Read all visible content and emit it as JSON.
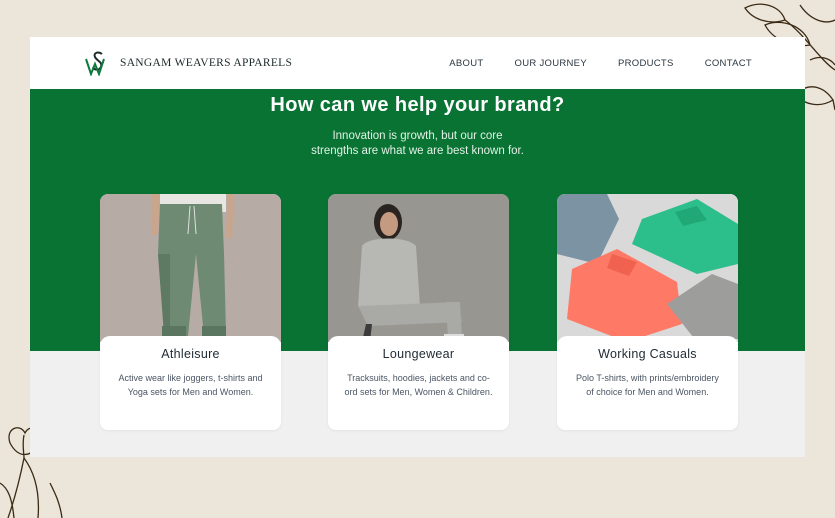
{
  "brand": {
    "name": "SANGAM WEAVERS APPARELS",
    "logo_icon": "sw-monogram-icon"
  },
  "nav": {
    "items": [
      {
        "label": "ABOUT"
      },
      {
        "label": "OUR JOURNEY"
      },
      {
        "label": "PRODUCTS"
      },
      {
        "label": "CONTACT"
      }
    ]
  },
  "hero": {
    "title": "How can we help your brand?",
    "subtitle_line1": "Innovation is growth, but our core",
    "subtitle_line2": "strengths are what we are best known for."
  },
  "cards": [
    {
      "title": "Athleisure",
      "description": "Active wear like joggers, t-shirts and Yoga sets for Men and Women."
    },
    {
      "title": "Loungewear",
      "description": "Tracksuits, hoodies, jackets and co-ord sets for Men, Women & Children."
    },
    {
      "title": "Working Casuals",
      "description": "Polo T-shirts, with prints/embroidery of choice for Men and Women."
    }
  ],
  "colors": {
    "brand_green": "#087333",
    "background": "#ebe5da",
    "section_grey": "#f0f0f0"
  }
}
